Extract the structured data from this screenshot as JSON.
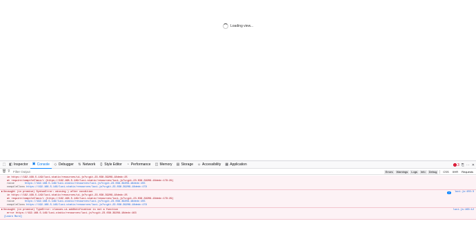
{
  "page": {
    "loading_text": "Loading view..."
  },
  "devtools": {
    "tabs": [
      {
        "label": "Inspector",
        "icon": "inspector-icon"
      },
      {
        "label": "Console",
        "icon": "console-icon"
      },
      {
        "label": "Debugger",
        "icon": "debugger-icon"
      },
      {
        "label": "Network",
        "icon": "network-icon"
      },
      {
        "label": "Style Editor",
        "icon": "style-editor-icon"
      },
      {
        "label": "Performance",
        "icon": "performance-icon"
      },
      {
        "label": "Memory",
        "icon": "memory-icon"
      },
      {
        "label": "Storage",
        "icon": "storage-icon"
      },
      {
        "label": "Accessibility",
        "icon": "accessibility-icon"
      },
      {
        "label": "Application",
        "icon": "application-icon"
      }
    ],
    "active_tab": "Console",
    "error_count": "3",
    "filter_placeholder": "Filter Output",
    "levels": [
      "Errors",
      "Warnings",
      "Logs",
      "Info",
      "Debug"
    ],
    "net_filters": [
      "CSS",
      "XHR",
      "Requests"
    ],
    "accent": "#0a84ff",
    "error_color": "#a4000f",
    "messages": [
      {
        "lines": [
          "in https://192.168.5.149/luci-static/resources/ui.js?v=git-23.038.39209-18dedc:25",
          "at require/compileClass/< (https://192.168.5.149/luci-static/resources/luci.js?v=git-23.038.39209-18dedc:179:29)"
        ],
        "stack": [
          {
            "fn": "raise",
            "url": "https://192.168.5.149/luci-static/resources/luci.js?v=git-23.038.39209-18dedc:155"
          },
          {
            "fn": "compileClass",
            "url": "https://192.168.5.149/luci-static/resources/luci.js?v=git-23.038.39209-18dedc:179"
          }
        ]
      },
      {
        "head": "Uncaught (in promise) SyntaxError: missing ) after condition",
        "lines": [
          "in https://192.168.5.149/luci-static/resources/ui.js?v=git-23.038.39209-18dedc:25",
          "at require/compileClass/< (https://192.168.5.149/luci-static/resources/luci.js?v=git-23.038.39209-18dedc:179:29)"
        ],
        "stack": [
          {
            "fn": "raise",
            "url": "https://192.168.5.149/luci-static/resources/luci.js?v=git-23.038.39209-18dedc:155"
          },
          {
            "fn": "compileClass",
            "url": "https://192.168.5.149/luci-static/resources/luci.js?v=git-23.038.39209-18dedc:179"
          }
        ],
        "count": "2",
        "location": "luci.js:155:3"
      },
      {
        "head": "Uncaught (in promise) TypeError: classes.ui.addNotification is not a function",
        "lines": [
          "error https://192.168.5.149/luci-static/resources/luci.js?v=git-23.038.39209-18dedc:163"
        ],
        "learn_more": "[Learn More]",
        "location": "luci.js:163:12"
      }
    ]
  }
}
